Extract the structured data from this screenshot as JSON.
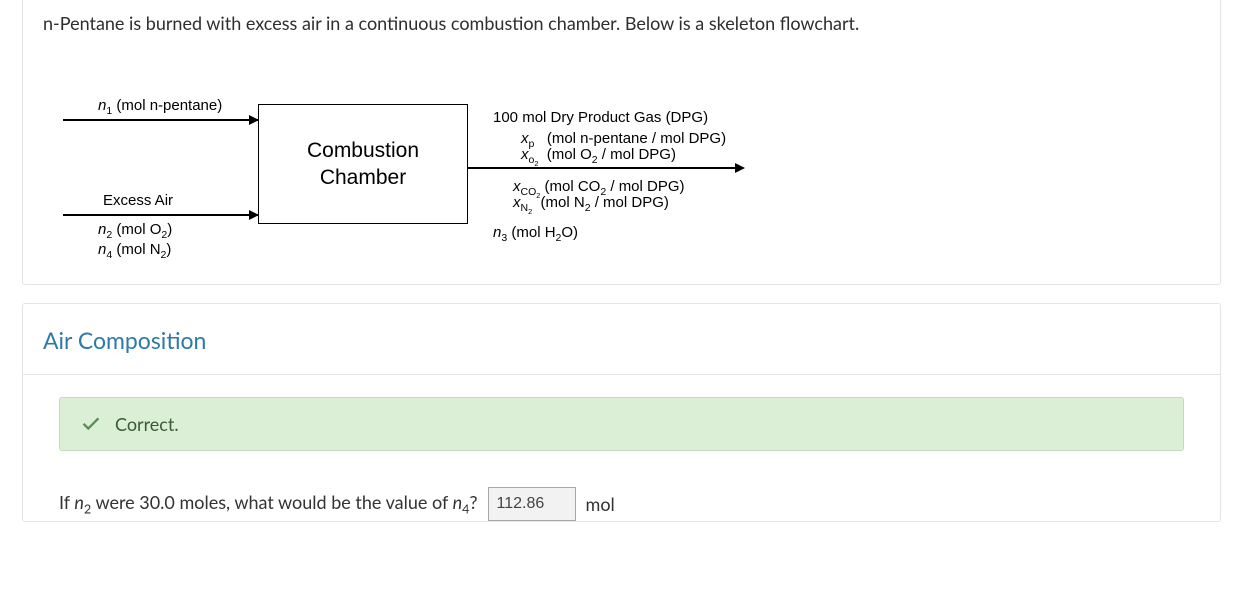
{
  "problem": {
    "text": "n-Pentane is burned with excess air in a continuous combustion chamber. Below is a skeleton flowchart."
  },
  "flowchart": {
    "box_label_line1": "Combustion",
    "box_label_line2": "Chamber",
    "in_top_label": "n₁ (mol n-pentane)",
    "in_bot_header": "Excess Air",
    "in_bot_line1": "n₂ (mol O₂)",
    "in_bot_line2": "n₄ (mol N₂)",
    "out_header": "100 mol Dry Product Gas (DPG)",
    "out_l1_sym": "xₚ",
    "out_l1_txt": "(mol n-pentane / mol DPG)",
    "out_l2_sym": "x₀₂",
    "out_l2_txt": "(mol O₂ / mol DPG)",
    "out_l3_sym": "xCO₂",
    "out_l3_txt": "(mol CO₂ / mol DPG)",
    "out_l4_sym": "xN₂",
    "out_l4_txt": "(mol N₂ / mol DPG)",
    "out_l5": "n₃ (mol H₂O)"
  },
  "section": {
    "title": "Air Composition",
    "feedback": "Correct.",
    "question_prefix": "If ",
    "question_var1": "n₂",
    "question_mid": " were 30.0 moles, what would be the value of ",
    "question_var2": "n₄",
    "question_suffix": "?",
    "answer_value": "112.86",
    "unit": "mol"
  }
}
